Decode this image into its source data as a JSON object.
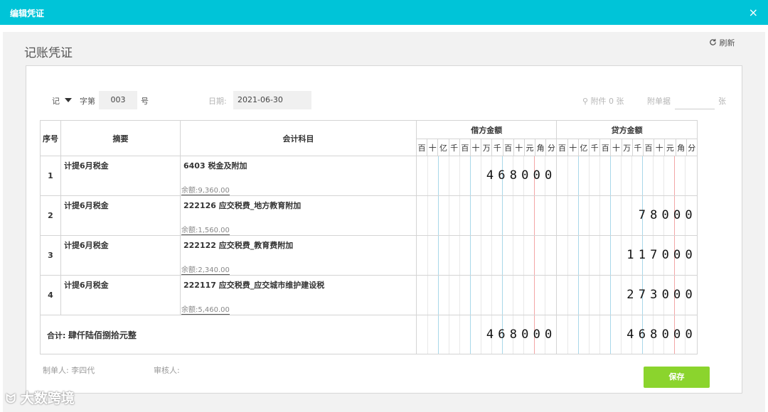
{
  "window": {
    "title": "编辑凭证",
    "close_icon": "×"
  },
  "page": {
    "title": "记账凭证",
    "refresh_label": "刷新"
  },
  "form": {
    "voucher_type": "记",
    "word_label": "字第",
    "number": "003",
    "number_suffix": "号",
    "date_label": "日期:",
    "date": "2021-06-30",
    "attachment_label": "附件 0 张",
    "attach_doc_label": "附单据",
    "attach_doc_value": "",
    "attach_unit": "张"
  },
  "table": {
    "headers": {
      "seq": "序号",
      "summary": "摘要",
      "account": "会计科目",
      "debit": "借方金额",
      "credit": "贷方金额"
    },
    "digit_units": [
      "百",
      "十",
      "亿",
      "千",
      "百",
      "十",
      "万",
      "千",
      "百",
      "十",
      "元",
      "角",
      "分"
    ],
    "rows": [
      {
        "seq": "1",
        "summary": "计提6月税金",
        "account": "6403 税金及附加",
        "balance_label": "余额:",
        "balance": "9,360.00",
        "debit": "468000",
        "credit": ""
      },
      {
        "seq": "2",
        "summary": "计提6月税金",
        "account": "222126 应交税费_地方教育附加",
        "balance_label": "余额:",
        "balance": "1,560.00",
        "debit": "",
        "credit": "78000"
      },
      {
        "seq": "3",
        "summary": "计提6月税金",
        "account": "222122 应交税费_教育费附加",
        "balance_label": "余额:",
        "balance": "2,340.00",
        "debit": "",
        "credit": "117000"
      },
      {
        "seq": "4",
        "summary": "计提6月税金",
        "account": "222117 应交税费_应交城市维护建设税",
        "balance_label": "余额:",
        "balance": "5,460.00",
        "debit": "",
        "credit": "273000"
      }
    ],
    "total": {
      "label": "合计:",
      "text": "肆仟陆佰捌拾元整",
      "debit": "468000",
      "credit": "468000"
    }
  },
  "footer": {
    "maker_label": "制单人:",
    "maker": "李四代",
    "reviewer_label": "审核人:",
    "reviewer": "",
    "save_label": "保存"
  },
  "watermark": "大数跨境",
  "colors": {
    "titlebar": "#00c4d8",
    "save": "#8bd42d",
    "yuan_line": "#f3a6a6",
    "group_line": "#a9d8ea"
  }
}
